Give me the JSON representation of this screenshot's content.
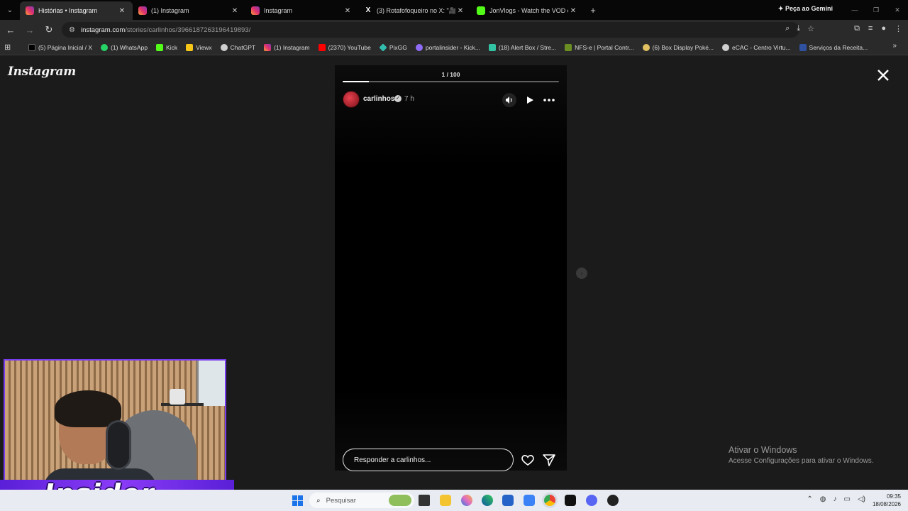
{
  "browser": {
    "tabs": [
      {
        "title": "Histórias • Instagram",
        "active": true,
        "favicon": "instagram-icon",
        "color": "#e1306c"
      },
      {
        "title": "(1) Instagram",
        "active": false,
        "favicon": "instagram-icon",
        "color": "#e1306c"
      },
      {
        "title": "Instagram",
        "active": false,
        "favicon": "instagram-icon",
        "color": "#e1306c"
      },
      {
        "title": "(3) Rotafofoqueiro no X: \"🎥 Br",
        "active": false,
        "favicon": "x-icon",
        "color": "#000000"
      },
      {
        "title": "JonVlogs - Watch the VOD on K",
        "active": false,
        "favicon": "kick-icon",
        "color": "#53fc18"
      }
    ],
    "gemini_label": "Peça ao Gemini",
    "url_host": "instagram.com",
    "url_path": "/stories/carlinhos/3966187263196419893/",
    "bookmarks": [
      {
        "label": "(5) Página Inicial / X",
        "icon": "x-icon",
        "color": "#000000"
      },
      {
        "label": "(1) WhatsApp",
        "icon": "whatsapp-icon",
        "color": "#25d366"
      },
      {
        "label": "Kick",
        "icon": "kick-icon",
        "color": "#53fc18"
      },
      {
        "label": "Viewx",
        "icon": "viewx-icon",
        "color": "#f5c518"
      },
      {
        "label": "ChatGPT",
        "icon": "chatgpt-icon",
        "color": "#cfcfcf"
      },
      {
        "label": "(1) Instagram",
        "icon": "instagram-icon",
        "color": "#e1306c"
      },
      {
        "label": "(2370) YouTube",
        "icon": "youtube-icon",
        "color": "#ff0000"
      },
      {
        "label": "PixGG",
        "icon": "pix-icon",
        "color": "#32bcad"
      },
      {
        "label": "portalinsider - Kick...",
        "icon": "portal-icon",
        "color": "#8f6cf7"
      },
      {
        "label": "(18) Alert Box / Stre...",
        "icon": "streamlabs-icon",
        "color": "#31c3a2"
      },
      {
        "label": "NFS-e | Portal Contr...",
        "icon": "nfse-icon",
        "color": "#6b8e23"
      },
      {
        "label": "(6) Box Display Poké...",
        "icon": "pokemon-icon",
        "color": "#e0c060"
      },
      {
        "label": "eCAC - Centro Virtu...",
        "icon": "ecac-icon",
        "color": "#d0d0d0"
      },
      {
        "label": "Serviços da Receita...",
        "icon": "receita-icon",
        "color": "#3050a0"
      }
    ]
  },
  "page": {
    "logo_text": "Instagram",
    "story": {
      "counter": "1 / 100",
      "progress": 0.12,
      "username": "carlinhos",
      "time": "7 h",
      "reply_placeholder": "Responder a carlinhos..."
    }
  },
  "overlay": {
    "activate_title": "Ativar o Windows",
    "activate_sub": "Acesse Configurações para ativar o Windows.",
    "brand_text": "Insider"
  },
  "taskbar": {
    "search_label": "Pesquisar",
    "time": "09:35",
    "date": "18/08/2026"
  }
}
